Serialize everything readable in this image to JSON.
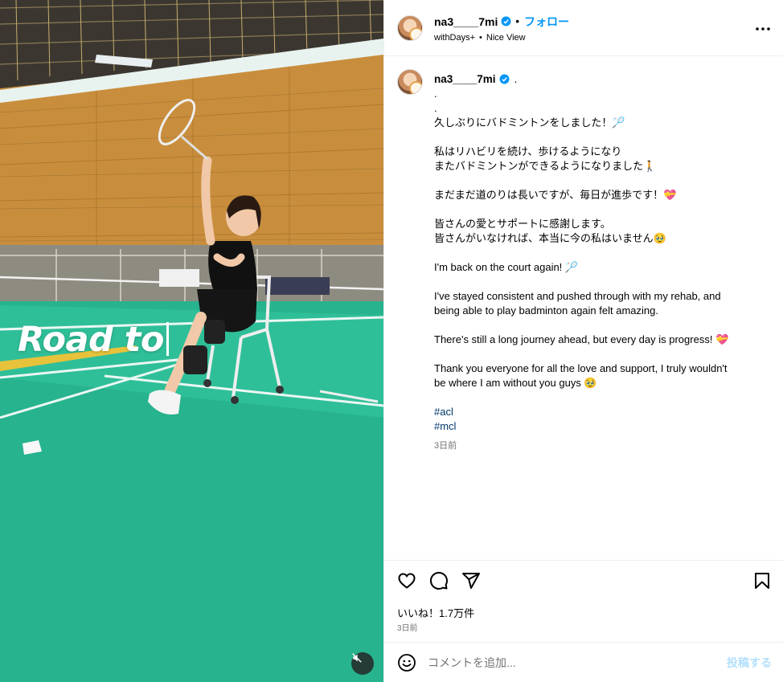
{
  "media": {
    "overlay_text": "Road to"
  },
  "header": {
    "username": "na3____7mi",
    "follow_label": "フォロー",
    "subtitle_left": "withDays+",
    "subtitle_sep": "•",
    "subtitle_right": "Nice View",
    "dot": "•"
  },
  "caption": {
    "username": "na3____7mi",
    "after_name": ".",
    "lines": [
      ".",
      ".",
      "久しぶりにバドミントンをしました！🏸",
      "",
      "私はリハビリを続け、歩けるようになり",
      "またバドミントンができるようになりました🚶",
      "",
      "まだまだ道のりは長いですが、毎日が進歩です！💝",
      "",
      "皆さんの愛とサポートに感謝します。",
      "皆さんがいなければ、本当に今の私はいません🥹",
      "",
      "I'm back on the court again! 🏸",
      "",
      "I've stayed consistent and pushed through with my rehab, and",
      "being able to play badminton again felt amazing.",
      "",
      "There's still a long journey ahead, but every day is progress! 💝",
      "",
      "Thank you everyone for all the love and support, I truly wouldn't",
      "be where I am without you guys 🥹",
      ""
    ],
    "hashtags": [
      "#acl",
      "#mcl"
    ],
    "time": "3日前"
  },
  "stats": {
    "likes": "いいね！1.7万件",
    "date": "3日前"
  },
  "comment": {
    "placeholder": "コメントを追加...",
    "post_label": "投稿する"
  },
  "colors": {
    "accent": "#0095f6",
    "court": "#27b38e",
    "hashtag": "#00376b"
  }
}
